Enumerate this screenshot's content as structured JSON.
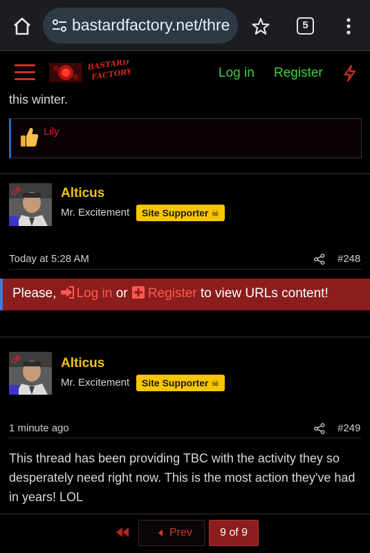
{
  "browser": {
    "url": "bastardfactory.net/thre",
    "tab_count": "5"
  },
  "header": {
    "logo_text_line1": "BASTARD",
    "logo_text_line2": "FACTORY",
    "login_label": "Log in",
    "register_label": "Register"
  },
  "previous_post": {
    "trailing_text": "this winter.",
    "reaction_user": "Lily"
  },
  "posts": [
    {
      "username": "Alticus",
      "user_title": "Mr. Excitement",
      "badge": "Site Supporter",
      "time": "Today at 5:28 AM",
      "number": "#248"
    },
    {
      "username": "Alticus",
      "user_title": "Mr. Excitement",
      "badge": "Site Supporter",
      "time": "1 minute ago",
      "number": "#249",
      "body": "This thread has been providing TBC with the activity they so desperately need right now. This is the most action they've had in years! LOL"
    }
  ],
  "notice": {
    "prefix": "Please,",
    "login_label": "Log in",
    "middle": "or",
    "register_label": "Register",
    "suffix": "to view URLs content!"
  },
  "pagination": {
    "prev_label": "Prev",
    "current": "9 of 9"
  },
  "colors": {
    "accent_red": "#d2302a",
    "link_green": "#3fcf3f",
    "username_yellow": "#f2c316",
    "badge_yellow": "#f8c600",
    "notice_bg": "#8b1d1d"
  }
}
